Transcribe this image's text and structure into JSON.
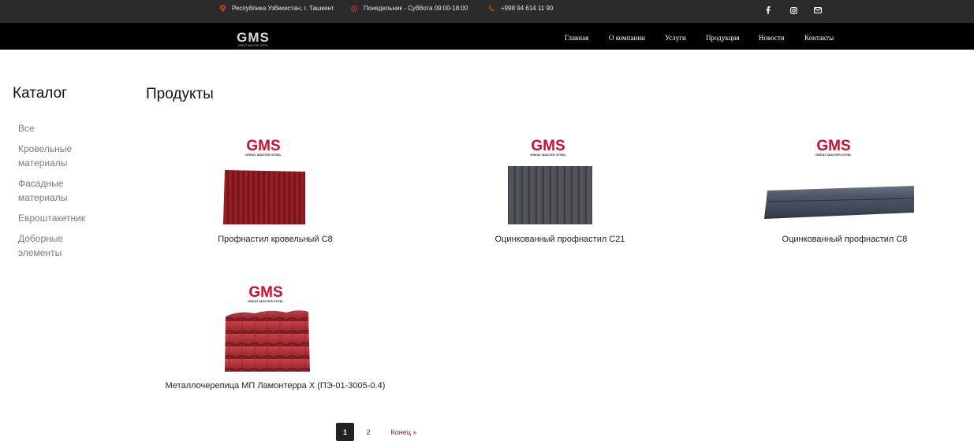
{
  "topbar": {
    "address": "Республика Узбекистан, г. Ташкент",
    "hours": "Понедельник - Суббота 09:00-18:00",
    "phone": "+998 94 614 11 90",
    "icons": [
      "map-pin-icon",
      "clock-icon",
      "phone-icon",
      "facebook-icon",
      "instagram-icon",
      "mail-icon"
    ],
    "icon_color": "#c0392b"
  },
  "header": {
    "logo_text": "GMS",
    "logo_sub": "GREAT MASTER STEEL",
    "nav": [
      {
        "label": "Главная"
      },
      {
        "label": "О компании"
      },
      {
        "label": "Услуги"
      },
      {
        "label": "Продукция"
      },
      {
        "label": "Новости"
      },
      {
        "label": "Контакты"
      }
    ]
  },
  "sidebar": {
    "title": "Каталог",
    "items": [
      {
        "label": "Все"
      },
      {
        "label": "Кровельные материалы"
      },
      {
        "label": "Фасадные материалы"
      },
      {
        "label": "Евроштакетник"
      },
      {
        "label": "Доборные элементы"
      }
    ]
  },
  "main": {
    "title": "Продукты",
    "brand_text": "GMS",
    "brand_sub": "GREAT MASTER STEEL",
    "brand_color": "#c8102e",
    "products": [
      {
        "name": "Профнастил кровельный С8",
        "color": "#8e1b22"
      },
      {
        "name": "Оцинкованный профнастил С21",
        "color": "#4a4d52"
      },
      {
        "name": "Оцинкованный профнастил С8",
        "color": "#4d5563"
      },
      {
        "name": "Металлочерепица МП Ламонтерра X (ПЭ-01-3005-0.4)",
        "color": "#b0323a"
      }
    ]
  },
  "pagination": {
    "pages": [
      "1",
      "2"
    ],
    "current": "1",
    "end_label": "Конец »"
  }
}
